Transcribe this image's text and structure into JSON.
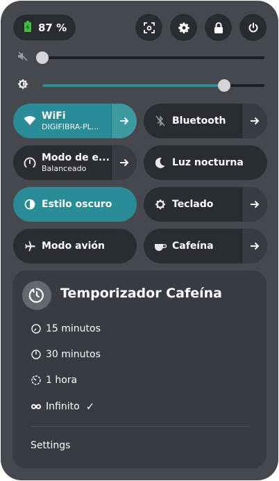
{
  "battery": {
    "percent": "87 %",
    "icon": "battery-charging-icon"
  },
  "header_buttons": [
    {
      "name": "screenshot-button",
      "icon": "screenshot-icon"
    },
    {
      "name": "settings-button",
      "icon": "gear-icon"
    },
    {
      "name": "lock-button",
      "icon": "lock-icon"
    },
    {
      "name": "power-button",
      "icon": "power-icon"
    }
  ],
  "sliders": {
    "volume": {
      "icon": "speaker-muted-icon",
      "value": 0.0
    },
    "brightness": {
      "icon": "brightness-icon",
      "value": 0.82
    }
  },
  "tiles": {
    "wifi": {
      "label": "WiFi",
      "subtitle": "DIGIFIBRA-PL...",
      "active": true
    },
    "bluetooth": {
      "label": "Bluetooth",
      "active": false
    },
    "power_mode": {
      "label": "Modo de e...",
      "subtitle": "Balanceado",
      "active": false
    },
    "night_light": {
      "label": "Luz nocturna",
      "active": false
    },
    "dark_style": {
      "label": "Estilo oscuro",
      "active": true
    },
    "keyboard": {
      "label": "Teclado",
      "active": false
    },
    "airplane": {
      "label": "Modo avión",
      "active": false
    },
    "caffeine": {
      "label": "Cafeína",
      "active": false
    }
  },
  "caffeine_menu": {
    "title": "Temporizador Cafeína",
    "items": [
      {
        "label": "15 minutos",
        "icon": "timer-15-icon"
      },
      {
        "label": "30 minutos",
        "icon": "timer-30-icon"
      },
      {
        "label": "1 hora",
        "icon": "timer-60-icon"
      },
      {
        "label": "Infinito",
        "icon": "infinity-icon",
        "checked": true
      }
    ],
    "check_mark": "✓",
    "settings_label": "Settings"
  },
  "colors": {
    "panel": "#46484d",
    "tile": "#2b2c30",
    "accent": "#2a8c96",
    "menu": "#393b41"
  }
}
